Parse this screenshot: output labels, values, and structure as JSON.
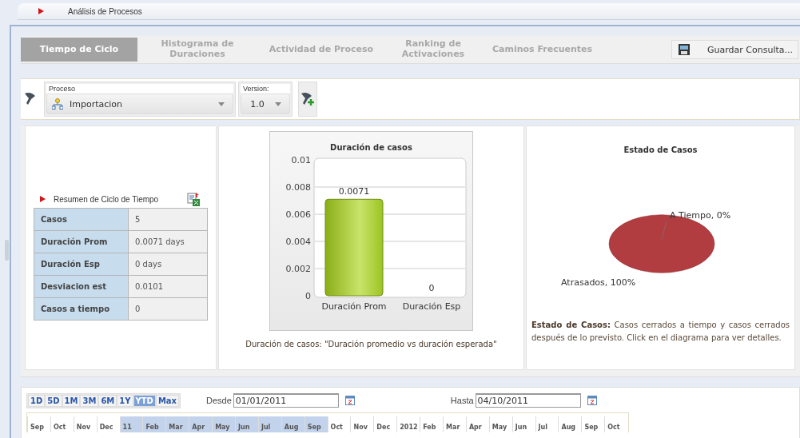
{
  "window": {
    "title": "Análisis de Procesos"
  },
  "tabs": [
    {
      "label": "Tiempo de Ciclo",
      "selected": true
    },
    {
      "label": "Histograma de Duraciones",
      "selected": false
    },
    {
      "label": "Actividad de Proceso",
      "selected": false
    },
    {
      "label": "Ranking de Activaciones",
      "selected": false
    },
    {
      "label": "Caminos Frecuentes",
      "selected": false
    }
  ],
  "save_button": "Guardar Consulta...",
  "filters": {
    "process": {
      "label": "Proceso",
      "value": "Importacion"
    },
    "version": {
      "label": "Version:",
      "value": "1.0"
    }
  },
  "summary": {
    "title": "Resumen de Ciclo de Tiempo",
    "rows": [
      {
        "label": "Casos",
        "value": "5"
      },
      {
        "label": "Duración Prom",
        "value": "0.0071 days"
      },
      {
        "label": "Duración Esp",
        "value": "0 days"
      },
      {
        "label": "Desviacion est",
        "value": "0.0101"
      },
      {
        "label": "Casos a tiempo",
        "value": "0"
      }
    ]
  },
  "duration_chart": {
    "caption": "Duración de casos: \"Duración promedio vs duración esperada\"",
    "chart_data": {
      "type": "bar",
      "title": "Duración de casos",
      "categories": [
        "Duración Prom",
        "Duración Esp"
      ],
      "values": [
        0.0071,
        0
      ],
      "ylim": [
        0,
        0.01
      ],
      "yticks": [
        0,
        0.002,
        0.004,
        0.006,
        0.008,
        0.01
      ],
      "grid": true,
      "data_labels": true
    }
  },
  "status_chart": {
    "caption_bold": "Estado de Casos:",
    "caption": "Casos cerrados a tiempo y casos cerrados después de lo previsto. Click en el diagrama para ver detalles.",
    "chart_data": {
      "type": "pie",
      "title": "Estado de Casos",
      "categories": [
        "A Tiempo, 0%",
        "Atrasados, 100%"
      ],
      "values": [
        0,
        100
      ]
    }
  },
  "ranges": [
    {
      "label": "1D",
      "selected": false
    },
    {
      "label": "5D",
      "selected": false
    },
    {
      "label": "1M",
      "selected": false
    },
    {
      "label": "3M",
      "selected": false
    },
    {
      "label": "6M",
      "selected": false
    },
    {
      "label": "1Y",
      "selected": false
    },
    {
      "label": "YTD",
      "selected": true
    },
    {
      "label": "Max",
      "selected": false
    }
  ],
  "from": {
    "label": "Desde",
    "value": "01/01/2011"
  },
  "to": {
    "label": "Hasta",
    "value": "04/10/2011"
  },
  "timeline": [
    {
      "label": "Sep",
      "selected": false
    },
    {
      "label": "Oct",
      "selected": false
    },
    {
      "label": "Nov",
      "selected": false
    },
    {
      "label": "Dec",
      "selected": false
    },
    {
      "label": "11",
      "selected": true
    },
    {
      "label": "Feb",
      "selected": true
    },
    {
      "label": "Mar",
      "selected": true
    },
    {
      "label": "Apr",
      "selected": true
    },
    {
      "label": "May",
      "selected": true
    },
    {
      "label": "Jun",
      "selected": true
    },
    {
      "label": "Jul",
      "selected": true
    },
    {
      "label": "Aug",
      "selected": true
    },
    {
      "label": "Sep",
      "selected": true
    },
    {
      "label": "Oct",
      "selected": false
    },
    {
      "label": "Nov",
      "selected": false
    },
    {
      "label": "Dec",
      "selected": false
    },
    {
      "label": "2012",
      "selected": false
    },
    {
      "label": "Feb",
      "selected": false
    },
    {
      "label": "Mar",
      "selected": false
    },
    {
      "label": "Apr",
      "selected": false
    },
    {
      "label": "May",
      "selected": false
    },
    {
      "label": "Jun",
      "selected": false
    },
    {
      "label": "Jul",
      "selected": false
    },
    {
      "label": "Aug",
      "selected": false
    },
    {
      "label": "Sep",
      "selected": false
    },
    {
      "label": "Oct",
      "selected": false
    }
  ]
}
